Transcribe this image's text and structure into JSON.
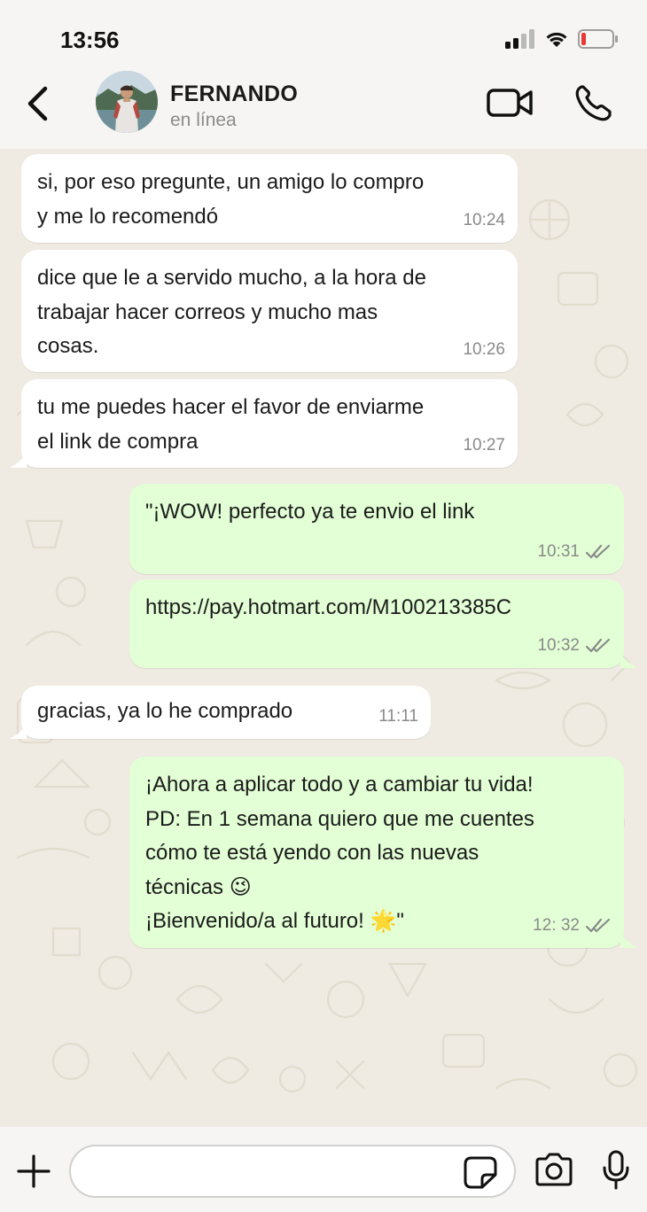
{
  "status_bar": {
    "time": "13:56",
    "icons": [
      "signal-icon",
      "wifi-icon",
      "battery-icon"
    ],
    "battery_level": 0.15
  },
  "header": {
    "contact_name": "FERNANDO",
    "contact_status": "en línea",
    "icons": [
      "back-arrow-icon",
      "avatar",
      "video-call-icon",
      "phone-call-icon"
    ]
  },
  "messages": [
    {
      "direction": "incoming",
      "text": "si, por eso pregunte, un amigo lo compro\ny me lo recomendó",
      "time": "10:24"
    },
    {
      "direction": "incoming",
      "text": "dice que le a servido mucho, a la hora de\ntrabajar hacer correos y mucho mas\ncosas.",
      "time": "10:26"
    },
    {
      "direction": "incoming",
      "text": "tu me puedes hacer el favor de enviarme\nel link de compra",
      "time": "10:27"
    },
    {
      "direction": "outgoing",
      "text": "\"¡WOW!  perfecto ya te envio el link",
      "time": "10:31",
      "status": "read"
    },
    {
      "direction": "outgoing",
      "text": "https://pay.hotmart.com/M100213385C",
      "time": "10:32",
      "status": "read"
    },
    {
      "direction": "incoming",
      "text": "gracias, ya  lo   he comprado",
      "time": "11:11"
    },
    {
      "direction": "outgoing",
      "text": "¡Ahora a aplicar todo y a cambiar tu vida!\nPD: En 1 semana quiero que me cuentes\ncómo te está yendo con las nuevas\ntécnicas 😉\n¡Bienvenido/a al futuro! 🌟\"",
      "time": "12: 32",
      "status": "read"
    }
  ],
  "input_bar": {
    "placeholder": "",
    "icons": [
      "plus-icon",
      "sticker-icon",
      "camera-icon",
      "microphone-icon"
    ]
  },
  "colors": {
    "incoming_bubble": "#ffffff",
    "outgoing_bubble": "#e2ffd5",
    "chat_background": "#efeae2",
    "read_ticks": "#8a8a8a"
  }
}
